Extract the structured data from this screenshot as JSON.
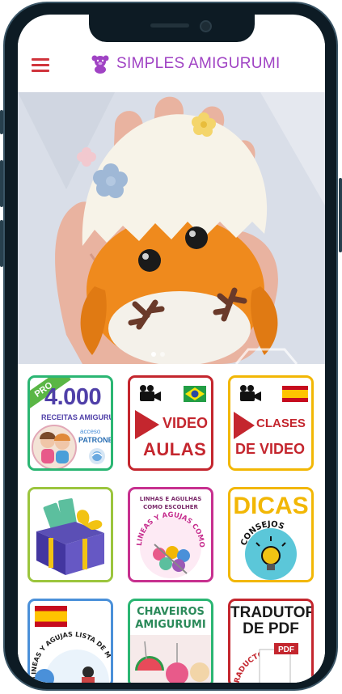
{
  "app": {
    "title": "SIMPLES AMIGURUMI"
  },
  "carousel": {
    "slides": 2,
    "active": 0
  },
  "tiles": {
    "t1": {
      "badge": "PRO",
      "count": "4.000",
      "subtitle": "RECEITAS AMIGURUMI",
      "acceso": "acceso",
      "patrones": "PATRONES"
    },
    "t2": {
      "line1": "VIDEO",
      "line2": "AULAS"
    },
    "t3": {
      "line1": "CLASES",
      "line2": "DE VIDEO"
    },
    "t5": {
      "line1": "LINHAS E AGULHAS",
      "line2": "COMO ESCOLHER",
      "curved": "LINEAS Y AGUJAS COMO ESCOGER"
    },
    "t6": {
      "title": "DICAS",
      "subtitle": "CONSEJOS"
    },
    "t7": {
      "curved": "LINEAS Y AGUJAS LISTA DE MATERIALES"
    },
    "t8": {
      "line1": "CHAVEIROS",
      "line2": "AMIGURUMI"
    },
    "t9": {
      "line1": "TRADUTOR",
      "line2": "DE PDF",
      "badge": "PDF",
      "curved": "TRADUCTOR PDF"
    }
  },
  "colors": {
    "brand": "#a043c4",
    "menu": "#d0343c",
    "red": "#c4262e",
    "green": "#2bb673",
    "yellow": "#f2b705"
  },
  "icons": [
    "menu-icon",
    "teddy-bear-icon",
    "video-camera-icon",
    "brazil-flag-icon",
    "spain-flag-icon",
    "play-icon",
    "lightbulb-icon",
    "gift-icon",
    "yarn-icon"
  ]
}
